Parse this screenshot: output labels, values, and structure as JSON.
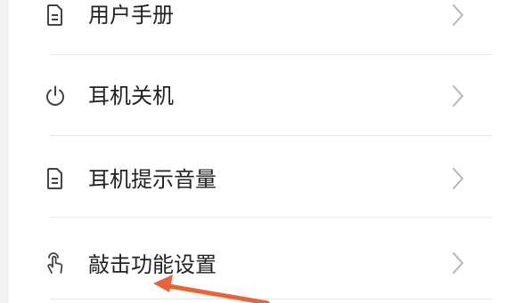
{
  "menu": {
    "items": [
      {
        "label": "用户手册",
        "icon": "document-icon"
      },
      {
        "label": "耳机关机",
        "icon": "power-icon"
      },
      {
        "label": "耳机提示音量",
        "icon": "document-icon"
      },
      {
        "label": "敲击功能设置",
        "icon": "tap-hand-icon"
      }
    ]
  },
  "colors": {
    "background": "#f1f1f3",
    "panel": "#ffffff",
    "text": "#222222",
    "icon": "#444444",
    "chevron": "#b5b5b8",
    "divider": "#e6e6e8",
    "annotation_arrow": "#e8633a"
  }
}
